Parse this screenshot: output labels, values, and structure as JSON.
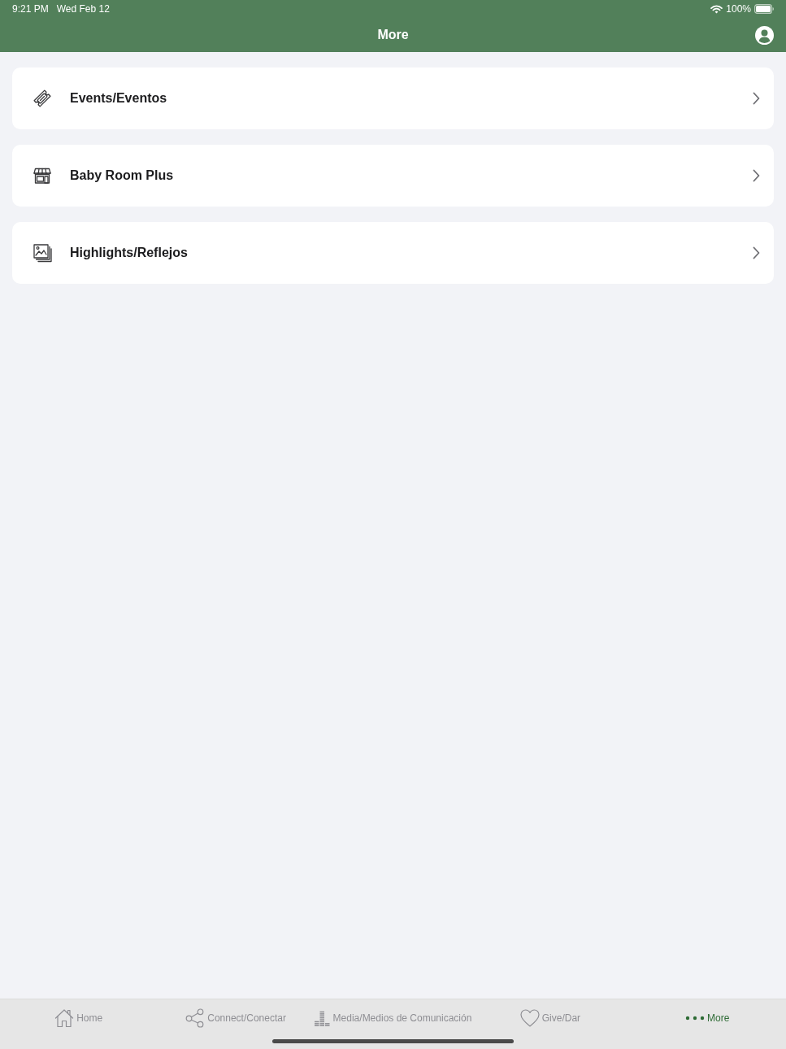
{
  "status_bar": {
    "time": "9:21 PM",
    "date": "Wed Feb 12",
    "battery": "100%"
  },
  "nav_bar": {
    "title": "More"
  },
  "menu_items": [
    {
      "label": "Events/Eventos"
    },
    {
      "label": "Baby Room Plus"
    },
    {
      "label": "Highlights/Reflejos"
    }
  ],
  "tab_bar": [
    {
      "label": "Home",
      "selected": false
    },
    {
      "label": "Connect/Conectar",
      "selected": false
    },
    {
      "label": "Media/Medios de Comunicación",
      "selected": false
    },
    {
      "label": "Give/Dar",
      "selected": false
    },
    {
      "label": "More",
      "selected": true
    }
  ]
}
